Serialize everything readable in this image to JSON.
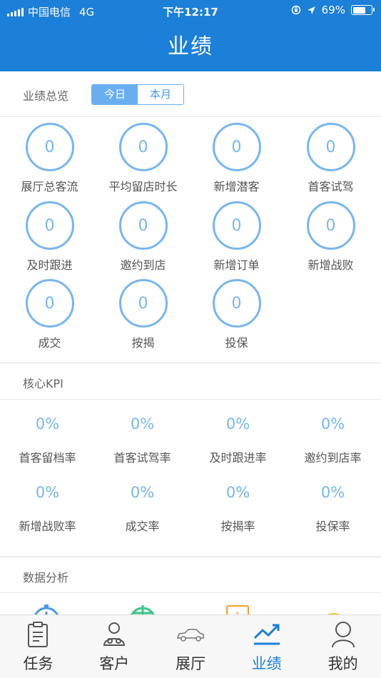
{
  "status": {
    "carrier": "中国电信",
    "network": "4G",
    "time": "下午12:17",
    "battery": "69%",
    "battery_level": 0.69
  },
  "header": {
    "title": "业绩"
  },
  "overview": {
    "title": "业绩总览",
    "tabs": [
      {
        "label": "今日",
        "active": true
      },
      {
        "label": "本月",
        "active": false
      }
    ],
    "items": [
      {
        "value": "0",
        "label": "展厅总客流"
      },
      {
        "value": "0",
        "label": "平均留店时长"
      },
      {
        "value": "0",
        "label": "新增潜客"
      },
      {
        "value": "0",
        "label": "首客试驾"
      },
      {
        "value": "0",
        "label": "及时跟进"
      },
      {
        "value": "0",
        "label": "邀约到店"
      },
      {
        "value": "0",
        "label": "新增订单"
      },
      {
        "value": "0",
        "label": "新增战败"
      },
      {
        "value": "0",
        "label": "成交"
      },
      {
        "value": "0",
        "label": "按揭"
      },
      {
        "value": "0",
        "label": "投保"
      }
    ]
  },
  "kpi": {
    "title": "核心KPI",
    "items": [
      {
        "value": "0%",
        "label": "首客留档率"
      },
      {
        "value": "0%",
        "label": "首客试驾率"
      },
      {
        "value": "0%",
        "label": "及时跟进率"
      },
      {
        "value": "0%",
        "label": "邀约到店率"
      },
      {
        "value": "0%",
        "label": "新增战败率"
      },
      {
        "value": "0%",
        "label": "成交率"
      },
      {
        "value": "0%",
        "label": "按揭率"
      },
      {
        "value": "0%",
        "label": "投保率"
      }
    ]
  },
  "analysis": {
    "title": "数据分析",
    "icons": [
      "timer-icon",
      "gauge-icon",
      "calendar-icon",
      "chart-icon"
    ],
    "calendar_day": "1",
    "colors": [
      "#4a98e6",
      "#3cc38a",
      "#f0a030",
      "#f5c842"
    ]
  },
  "tabbar": {
    "items": [
      {
        "label": "任务",
        "icon": "clipboard-icon"
      },
      {
        "label": "客户",
        "icon": "customers-icon"
      },
      {
        "label": "展厅",
        "icon": "car-icon"
      },
      {
        "label": "业绩",
        "icon": "trend-icon",
        "active": true
      },
      {
        "label": "我的",
        "icon": "profile-icon"
      }
    ]
  },
  "colors": {
    "primary": "#1c7fd8",
    "accent": "#78b6ee",
    "tab_active": "#1c7fd8"
  }
}
